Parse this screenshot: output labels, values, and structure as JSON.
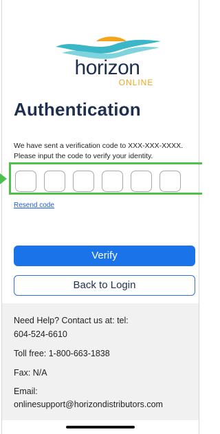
{
  "logo": {
    "brand": "horizon",
    "tagline": "ONLINE"
  },
  "title": "Authentication",
  "description": "We have sent a verification code to XXX-XXX-XXXX. Please input the code to verify your identity.",
  "code_inputs": [
    "",
    "",
    "",
    "",
    "",
    ""
  ],
  "resend_label": "Resend code",
  "verify_label": "Verify",
  "back_label": "Back to Login",
  "help": {
    "line1a": "Need Help? Contact us at: tel:",
    "line1b": "604-524-6610",
    "toll_free": "Toll free: 1-800-663-1838",
    "fax": "Fax: N/A",
    "email_label": "Email:",
    "email": "onlinesupport@horizondistributors.com"
  },
  "colors": {
    "primary": "#1a73e8",
    "title": "#1f2f4f",
    "highlight": "#4cc24a",
    "logo_teal": "#3bb6c6",
    "logo_orange": "#f2a51c"
  }
}
